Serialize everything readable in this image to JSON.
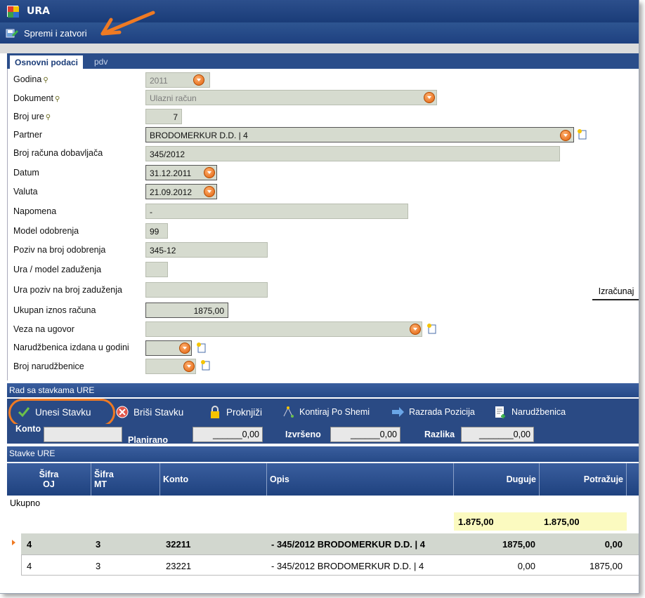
{
  "window": {
    "title": "URA"
  },
  "toolbar": {
    "save_label": "Spremi i zatvori"
  },
  "tabs": [
    {
      "label": "Osnovni podaci"
    },
    {
      "label": "pdv"
    }
  ],
  "form": {
    "godina": {
      "label": "Godina",
      "value": "2011"
    },
    "dokument": {
      "label": "Dokument",
      "value": "Ulazni račun"
    },
    "broj_ure": {
      "label": "Broj ure",
      "value": "7"
    },
    "partner": {
      "label": "Partner",
      "value": "BRODOMERKUR D.D. | 4"
    },
    "broj_racuna": {
      "label": "Broj računa dobavljača",
      "value": "345/2012"
    },
    "datum": {
      "label": "Datum",
      "value": "31.12.2011"
    },
    "valuta": {
      "label": "Valuta",
      "value": "21.09.2012"
    },
    "napomena": {
      "label": "Napomena",
      "value": "-"
    },
    "model_odobrenja": {
      "label": "Model odobrenja",
      "value": "99"
    },
    "poziv_odobrenja": {
      "label": "Poziv na broj odobrenja",
      "value": "345-12"
    },
    "model_zaduzenja": {
      "label": "Ura / model zaduženja",
      "value": ""
    },
    "poziv_zaduzenja": {
      "label": "Ura poziv na broj zaduženja",
      "value": ""
    },
    "ukupan_iznos": {
      "label": "Ukupan iznos računa",
      "value": "1875,00"
    },
    "veza_ugovor": {
      "label": "Veza na ugovor",
      "value": ""
    },
    "narudzbenica_godina": {
      "label": "Narudžbenica izdana u godini",
      "value": ""
    },
    "broj_narudzbenice": {
      "label": "Broj narudžbenice",
      "value": ""
    },
    "izracunaj_label": "Izračunaj"
  },
  "stavke_section": {
    "title": "Rad sa stavkama URE"
  },
  "actions": {
    "unesi": "Unesi Stavku",
    "brisi": "Briši Stavku",
    "proknjizi": "Proknjiži",
    "kontiraj": "Kontiraj Po Shemi",
    "razrada": "Razrada Pozicija",
    "narudzbenica": "Narudžbenica"
  },
  "summary": {
    "konto_label": "Konto",
    "planirano_label": "Planirano",
    "planirano_value": "______0,00",
    "izvrseno_label": "Izvršeno",
    "izvrseno_value": "______0,00",
    "razlika_label": "Razlika",
    "razlika_value": "_______0,00"
  },
  "grid": {
    "title": "Stavke URE",
    "columns": {
      "sifra_oj": [
        "Šifra",
        "OJ"
      ],
      "sifra_mt": [
        "Šifra",
        "MT"
      ],
      "konto": "Konto",
      "opis": "Opis",
      "duguje": "Duguje",
      "potrazuje": "Potražuje"
    },
    "ukupno_label": "Ukupno",
    "total_duguje": "1.875,00",
    "total_potrazuje": "1.875,00",
    "rows": [
      {
        "oj": "4",
        "mt": "3",
        "konto": "32211",
        "opis": "- 345/2012 BRODOMERKUR D.D. | 4",
        "duguje": "1875,00",
        "potrazuje": "0,00"
      },
      {
        "oj": "4",
        "mt": "3",
        "konto": "23221",
        "opis": "- 345/2012 BRODOMERKUR D.D. | 4",
        "duguje": "0,00",
        "potrazuje": "1875,00"
      }
    ]
  },
  "colors": {
    "accent_orange": "#ef7a23",
    "header_blue": "#2a4a84",
    "field_bg": "#d6dbcf",
    "totals_bg": "#fbfac0"
  }
}
